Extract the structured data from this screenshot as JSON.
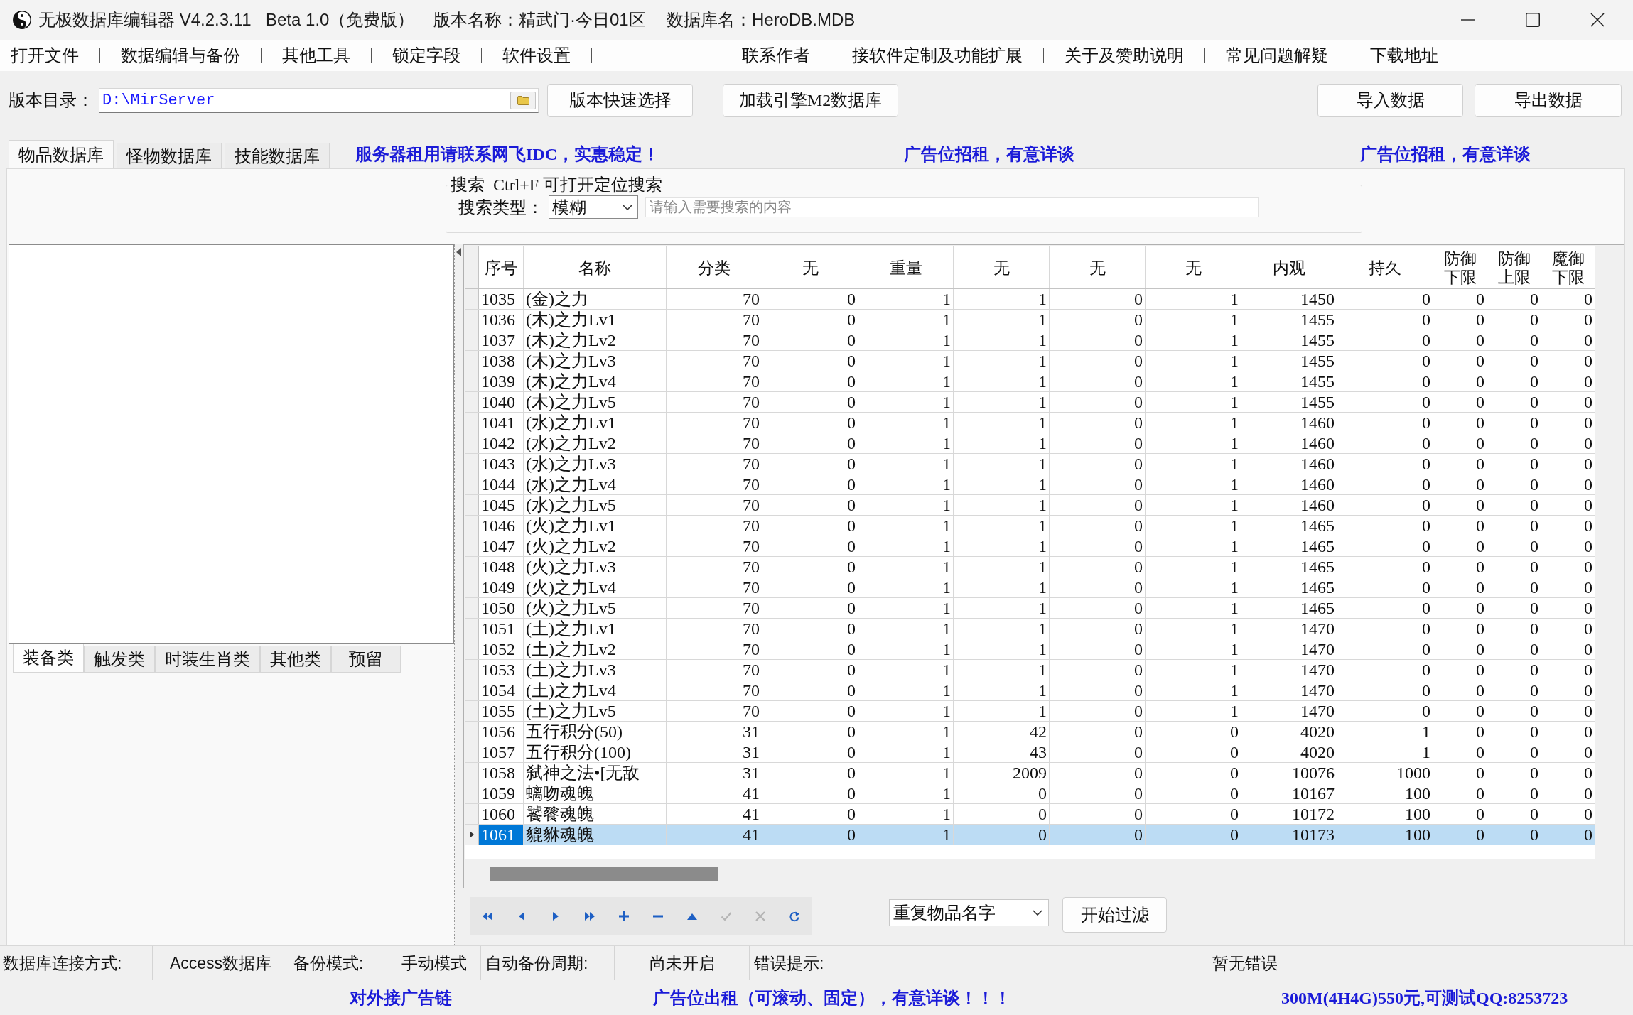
{
  "window": {
    "title_segments": [
      "无极数据库编辑器 V4.2.3.11",
      "Beta 1.0（免费版）",
      "版本名称：精武门·今日01区",
      "数据库名：HeroDB.MDB"
    ]
  },
  "menu_bar": {
    "items": [
      "打开文件",
      "数据编辑与备份",
      "其他工具",
      "锁定字段",
      "软件设置"
    ],
    "links": [
      "联系作者",
      "接软件定制及功能扩展",
      "关于及赞助说明",
      "常见问题解疑",
      "下载地址"
    ]
  },
  "toolbar": {
    "path_label": "版本目录：",
    "path_value": "D:\\MirServer",
    "buttons": [
      "版本快速选择",
      "加载引擎M2数据库"
    ],
    "data_buttons": [
      "导入数据",
      "导出数据"
    ]
  },
  "tabs": [
    {
      "label": "物品数据库",
      "selected": true
    },
    {
      "label": "怪物数据库",
      "selected": false
    },
    {
      "label": "技能数据库",
      "selected": false
    }
  ],
  "ad_banners": [
    "服务器租用请联系网飞IDC，实惠稳定！",
    "广告位招租，有意详谈",
    "广告位招租，有意详谈"
  ],
  "search": {
    "legend": "搜索  Ctrl+F 可打开定位搜索",
    "type_label": "搜索类型：",
    "type_value": "模糊",
    "placeholder": "请输入需要搜索的内容"
  },
  "category_tabs": [
    {
      "label": "装备类",
      "selected": true
    },
    {
      "label": "触发类",
      "selected": false
    },
    {
      "label": "时装生肖类",
      "selected": false
    },
    {
      "label": "其他类",
      "selected": false
    },
    {
      "label": "预留",
      "selected": false
    }
  ],
  "table": {
    "columns": [
      "序号",
      "名称",
      "分类",
      "无",
      "重量",
      "无",
      "无",
      "无",
      "内观",
      "持久",
      "防御下限",
      "防御上限",
      "魔御下限"
    ],
    "rows": [
      {
        "cells": [
          "1035",
          "(金)之力",
          "70",
          "0",
          "1",
          "1",
          "0",
          "1",
          "1450",
          "0",
          "0",
          "0",
          "0"
        ],
        "selected": false
      },
      {
        "cells": [
          "1036",
          "(木)之力Lv1",
          "70",
          "0",
          "1",
          "1",
          "0",
          "1",
          "1455",
          "0",
          "0",
          "0",
          "0"
        ],
        "selected": false
      },
      {
        "cells": [
          "1037",
          "(木)之力Lv2",
          "70",
          "0",
          "1",
          "1",
          "0",
          "1",
          "1455",
          "0",
          "0",
          "0",
          "0"
        ],
        "selected": false
      },
      {
        "cells": [
          "1038",
          "(木)之力Lv3",
          "70",
          "0",
          "1",
          "1",
          "0",
          "1",
          "1455",
          "0",
          "0",
          "0",
          "0"
        ],
        "selected": false
      },
      {
        "cells": [
          "1039",
          "(木)之力Lv4",
          "70",
          "0",
          "1",
          "1",
          "0",
          "1",
          "1455",
          "0",
          "0",
          "0",
          "0"
        ],
        "selected": false
      },
      {
        "cells": [
          "1040",
          "(木)之力Lv5",
          "70",
          "0",
          "1",
          "1",
          "0",
          "1",
          "1455",
          "0",
          "0",
          "0",
          "0"
        ],
        "selected": false
      },
      {
        "cells": [
          "1041",
          "(水)之力Lv1",
          "70",
          "0",
          "1",
          "1",
          "0",
          "1",
          "1460",
          "0",
          "0",
          "0",
          "0"
        ],
        "selected": false
      },
      {
        "cells": [
          "1042",
          "(水)之力Lv2",
          "70",
          "0",
          "1",
          "1",
          "0",
          "1",
          "1460",
          "0",
          "0",
          "0",
          "0"
        ],
        "selected": false
      },
      {
        "cells": [
          "1043",
          "(水)之力Lv3",
          "70",
          "0",
          "1",
          "1",
          "0",
          "1",
          "1460",
          "0",
          "0",
          "0",
          "0"
        ],
        "selected": false
      },
      {
        "cells": [
          "1044",
          "(水)之力Lv4",
          "70",
          "0",
          "1",
          "1",
          "0",
          "1",
          "1460",
          "0",
          "0",
          "0",
          "0"
        ],
        "selected": false
      },
      {
        "cells": [
          "1045",
          "(水)之力Lv5",
          "70",
          "0",
          "1",
          "1",
          "0",
          "1",
          "1460",
          "0",
          "0",
          "0",
          "0"
        ],
        "selected": false
      },
      {
        "cells": [
          "1046",
          "(火)之力Lv1",
          "70",
          "0",
          "1",
          "1",
          "0",
          "1",
          "1465",
          "0",
          "0",
          "0",
          "0"
        ],
        "selected": false
      },
      {
        "cells": [
          "1047",
          "(火)之力Lv2",
          "70",
          "0",
          "1",
          "1",
          "0",
          "1",
          "1465",
          "0",
          "0",
          "0",
          "0"
        ],
        "selected": false
      },
      {
        "cells": [
          "1048",
          "(火)之力Lv3",
          "70",
          "0",
          "1",
          "1",
          "0",
          "1",
          "1465",
          "0",
          "0",
          "0",
          "0"
        ],
        "selected": false
      },
      {
        "cells": [
          "1049",
          "(火)之力Lv4",
          "70",
          "0",
          "1",
          "1",
          "0",
          "1",
          "1465",
          "0",
          "0",
          "0",
          "0"
        ],
        "selected": false
      },
      {
        "cells": [
          "1050",
          "(火)之力Lv5",
          "70",
          "0",
          "1",
          "1",
          "0",
          "1",
          "1465",
          "0",
          "0",
          "0",
          "0"
        ],
        "selected": false
      },
      {
        "cells": [
          "1051",
          "(土)之力Lv1",
          "70",
          "0",
          "1",
          "1",
          "0",
          "1",
          "1470",
          "0",
          "0",
          "0",
          "0"
        ],
        "selected": false
      },
      {
        "cells": [
          "1052",
          "(土)之力Lv2",
          "70",
          "0",
          "1",
          "1",
          "0",
          "1",
          "1470",
          "0",
          "0",
          "0",
          "0"
        ],
        "selected": false
      },
      {
        "cells": [
          "1053",
          "(土)之力Lv3",
          "70",
          "0",
          "1",
          "1",
          "0",
          "1",
          "1470",
          "0",
          "0",
          "0",
          "0"
        ],
        "selected": false
      },
      {
        "cells": [
          "1054",
          "(土)之力Lv4",
          "70",
          "0",
          "1",
          "1",
          "0",
          "1",
          "1470",
          "0",
          "0",
          "0",
          "0"
        ],
        "selected": false
      },
      {
        "cells": [
          "1055",
          "(土)之力Lv5",
          "70",
          "0",
          "1",
          "1",
          "0",
          "1",
          "1470",
          "0",
          "0",
          "0",
          "0"
        ],
        "selected": false
      },
      {
        "cells": [
          "1056",
          "五行积分(50)",
          "31",
          "0",
          "1",
          "42",
          "0",
          "0",
          "4020",
          "1",
          "0",
          "0",
          "0"
        ],
        "selected": false
      },
      {
        "cells": [
          "1057",
          "五行积分(100)",
          "31",
          "0",
          "1",
          "43",
          "0",
          "0",
          "4020",
          "1",
          "0",
          "0",
          "0"
        ],
        "selected": false
      },
      {
        "cells": [
          "1058",
          "弑神之法•[无敌",
          "31",
          "0",
          "1",
          "2009",
          "0",
          "0",
          "10076",
          "1000",
          "0",
          "0",
          "0"
        ],
        "selected": false
      },
      {
        "cells": [
          "1059",
          "螭吻魂魄",
          "41",
          "0",
          "1",
          "0",
          "0",
          "0",
          "10167",
          "100",
          "0",
          "0",
          "0"
        ],
        "selected": false
      },
      {
        "cells": [
          "1060",
          "饕餮魂魄",
          "41",
          "0",
          "1",
          "0",
          "0",
          "0",
          "10172",
          "100",
          "0",
          "0",
          "0"
        ],
        "selected": false
      },
      {
        "cells": [
          "1061",
          "貔貅魂魄",
          "41",
          "0",
          "1",
          "0",
          "0",
          "0",
          "10173",
          "100",
          "0",
          "0",
          "0"
        ],
        "selected": true
      }
    ]
  },
  "navigator": [
    {
      "kind": "first",
      "disabled": false
    },
    {
      "kind": "prior",
      "disabled": false
    },
    {
      "kind": "next",
      "disabled": false
    },
    {
      "kind": "last",
      "disabled": false
    },
    {
      "kind": "insert",
      "disabled": false
    },
    {
      "kind": "delete",
      "disabled": false
    },
    {
      "kind": "edit",
      "disabled": false
    },
    {
      "kind": "post",
      "disabled": true
    },
    {
      "kind": "cancel",
      "disabled": true
    },
    {
      "kind": "refresh",
      "disabled": false
    }
  ],
  "filter": {
    "value": "重复物品名字",
    "button": "开始过滤"
  },
  "status_bar": [
    {
      "label": "数据库连接方式:",
      "value": "Access数据库"
    },
    {
      "label": "备份模式:",
      "value": "手动模式"
    },
    {
      "label": "自动备份周期:",
      "value": "尚未开启"
    },
    {
      "label": "错误提示:",
      "value": "暂无错误"
    }
  ],
  "footer_links": [
    "对外接广告链",
    "广告位出租（可滚动、固定），有意详谈！！！",
    "300M(4H4G)550元,可测试QQ:8253723"
  ]
}
